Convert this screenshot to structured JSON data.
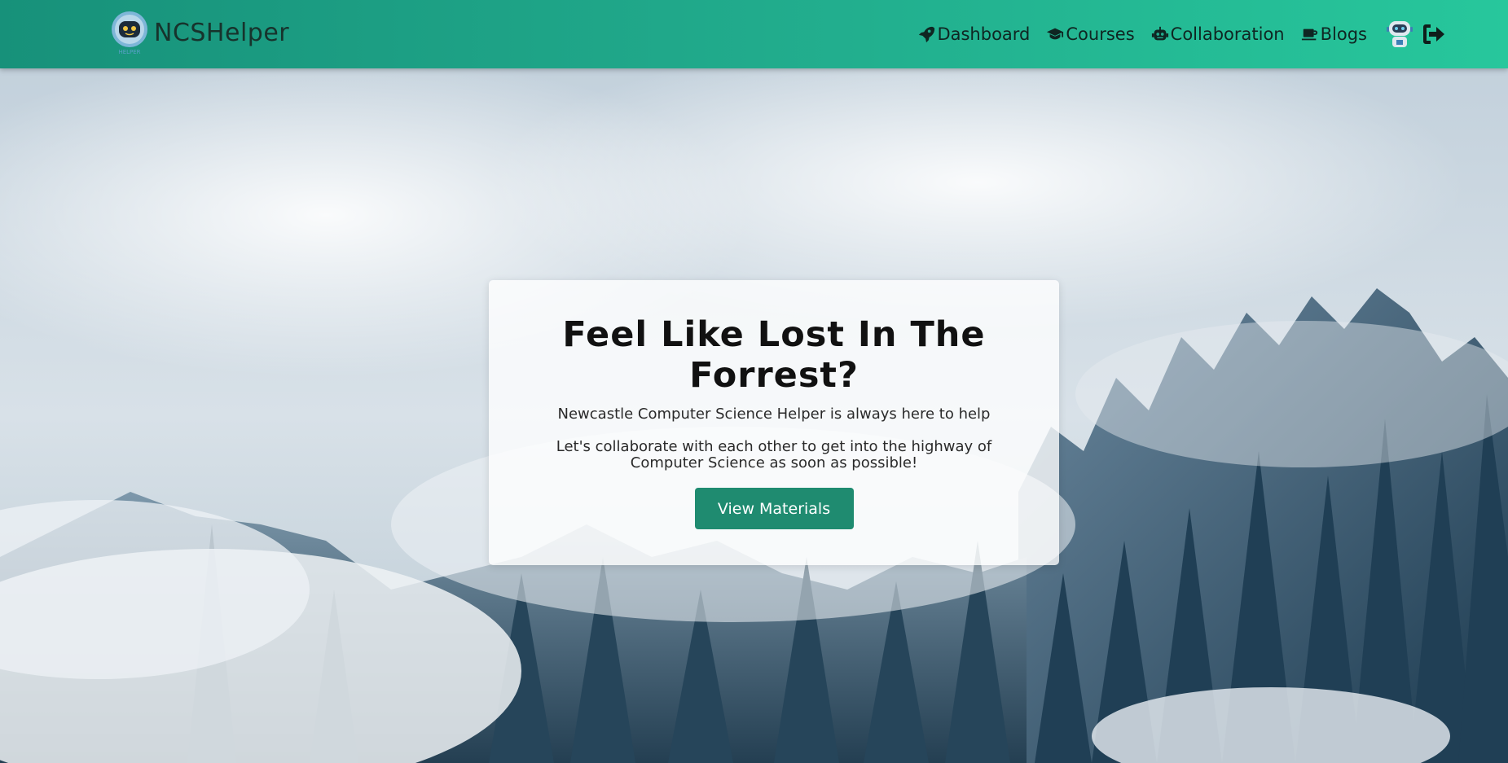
{
  "navbar": {
    "brand": "NCSHelper",
    "logo_caption": "HELPER",
    "items": [
      {
        "label": "Dashboard",
        "icon": "rocket-icon"
      },
      {
        "label": "Courses",
        "icon": "graduation-cap-icon"
      },
      {
        "label": "Collaboration",
        "icon": "robot-icon"
      },
      {
        "label": "Blogs",
        "icon": "coffee-cup-icon"
      }
    ],
    "avatar": "robot-avatar",
    "logout_icon": "sign-out-icon"
  },
  "hero": {
    "title": "Feel Like Lost In The Forrest?",
    "subtitle": "Newcastle Computer Science Helper is always here to help",
    "body": "Let's collaborate with each other to get into the highway of Computer Science as soon as possible!",
    "button_label": "View Materials"
  },
  "colors": {
    "navbar_start": "#17917a",
    "navbar_end": "#27c79c",
    "button": "#1f8b70"
  }
}
